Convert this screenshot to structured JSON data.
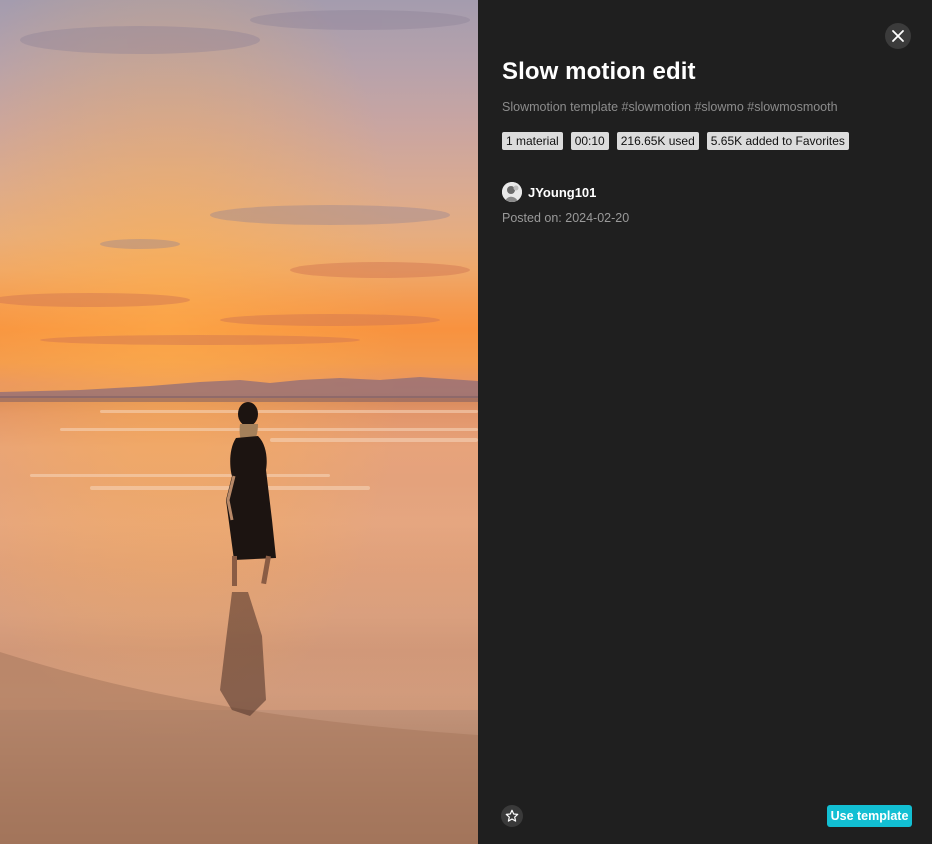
{
  "preview": {
    "scene_icon": "beach-sunset-photo"
  },
  "panel": {
    "title": "Slow motion edit",
    "description": "Slowmotion template #slowmotion #slowmo #slowmosmooth",
    "badges": {
      "materials": "1 material",
      "duration": "00:10",
      "uses": "216.65K used",
      "favorites": "5.65K added to Favorites"
    },
    "author": {
      "name": "JYoung101"
    },
    "posted": "Posted on: 2024-02-20",
    "actions": {
      "use_template": "Use template"
    },
    "icons": {
      "close": "close-icon",
      "favorite": "star-icon"
    },
    "colors": {
      "accent": "#12bfd3",
      "panel_background": "#1f1f1f",
      "badge_background": "#dcdcdc"
    }
  }
}
